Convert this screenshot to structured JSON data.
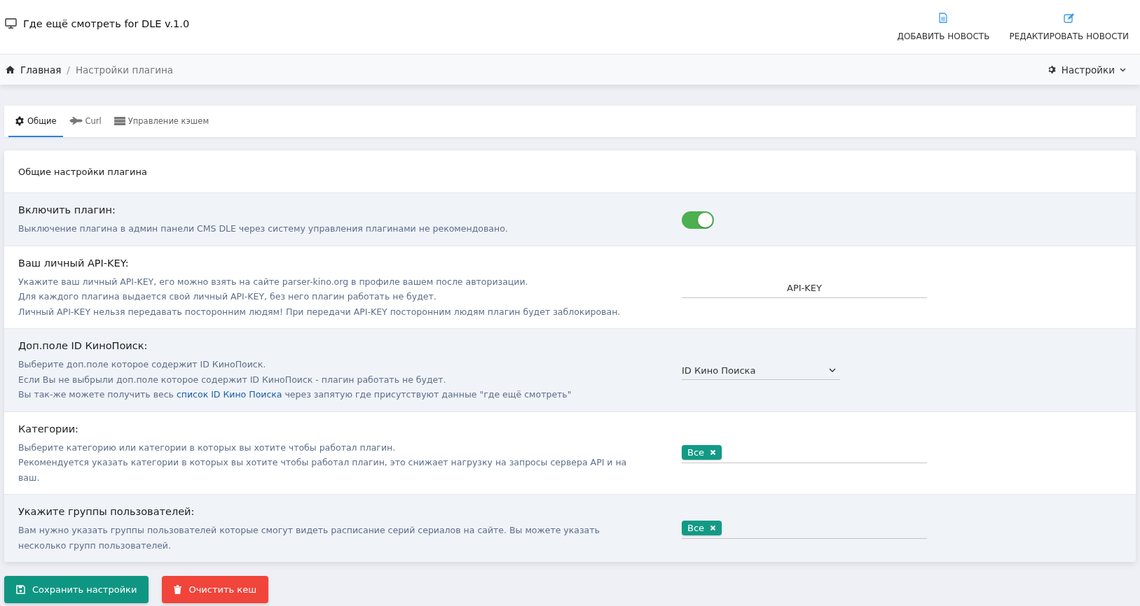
{
  "header": {
    "title": "Где ещё смотреть for DLE v.1.0",
    "actions": [
      {
        "label": "ДОБАВИТЬ НОВОСТЬ",
        "kind": "add"
      },
      {
        "label": "РЕДАКТИРОВАТЬ НОВОСТИ",
        "kind": "edit"
      }
    ]
  },
  "breadcrumb": {
    "items": [
      "Главная",
      "Настройки плагина"
    ],
    "separator": "/",
    "settings_menu": "Настройки"
  },
  "tabs": [
    {
      "label": "Общие",
      "kind": "gear",
      "selected": true
    },
    {
      "label": "Curl",
      "kind": "plane",
      "selected": false
    },
    {
      "label": "Управление кэшем",
      "kind": "server",
      "selected": false
    }
  ],
  "panel": {
    "title": "Общие настройки плагина",
    "rows": [
      {
        "kind": "toggle",
        "label": "Включить плагин:",
        "description": [
          [
            {
              "text": "Выключение плагина в админ панели CMS DLE через систему управления плагинами не рекомендовано."
            }
          ]
        ],
        "on": true
      },
      {
        "kind": "text",
        "label": "Ваш личный API-KEY:",
        "description": [
          [
            {
              "text": "Укажите ваш личный API-KEY, его можно взять на сайте parser-kino.org в профиле вашем после авторизации."
            }
          ],
          [
            {
              "text": "Для каждого плагина выдается свой личный API-KEY, без него плагин работать не будет."
            }
          ],
          [
            {
              "text": "Личный API-KEY нельзя передавать посторонним людям! При передачи API-KEY посторонним людям плагин будет заблокирован."
            }
          ]
        ],
        "placeholder": "API-KEY"
      },
      {
        "kind": "select",
        "label": "Доп.поле ID КиноПоиск:",
        "description": [
          [
            {
              "text": "Выберите доп.поле которое содержит ID КиноПоиск."
            }
          ],
          [
            {
              "text": "Если Вы не выбрыли доп.поле которое содержит ID КиноПоиск - плагин работать не будет."
            }
          ],
          [
            {
              "text": "Вы так-же можете получить весь "
            },
            {
              "text": "список ID Кино Поиска",
              "kind": "link"
            },
            {
              "text": " через запятую где присутствуют данные \"где ещё смотреть\""
            }
          ]
        ],
        "value": "ID Кино Поиска"
      },
      {
        "kind": "tags",
        "label": "Категории:",
        "description": [
          [
            {
              "text": "Выберите категорию или категории в которых вы хотите чтобы работал плагин."
            }
          ],
          [
            {
              "text": "Рекомендуется указать категории в которых вы хотите чтобы работал плагин, это снижает нагрузку на запросы сервера API и на ваш."
            }
          ]
        ],
        "tags": [
          "Все"
        ]
      },
      {
        "kind": "tags",
        "label": "Укажите группы пользователей:",
        "description": [
          [
            {
              "text": "Вам нужно указать группы пользователей которые смогут видеть расписание серий сериалов на сайте. Вы можете указать несколько групп пользователей."
            }
          ]
        ],
        "tags": [
          "Все"
        ]
      }
    ]
  },
  "buttons": [
    {
      "label": "Сохранить настройки",
      "kind": "save"
    },
    {
      "label": "Очистить кеш",
      "kind": "clear"
    }
  ]
}
